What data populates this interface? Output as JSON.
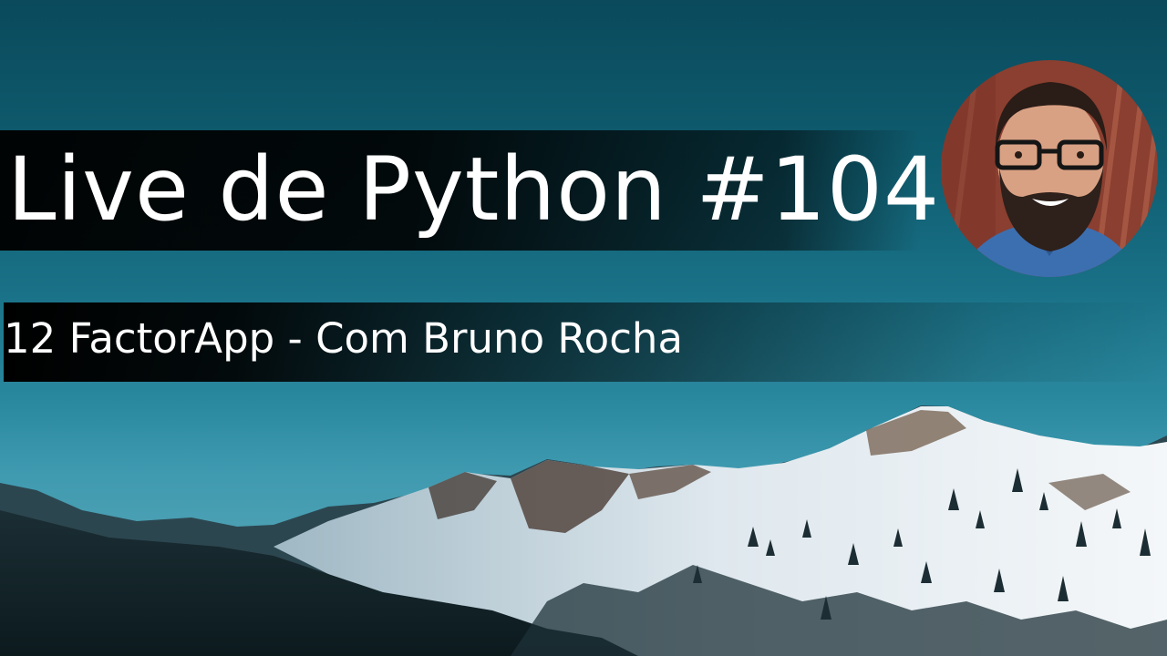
{
  "title": "Live de Python #104",
  "subtitle": "12 FactorApp - Com Bruno Rocha",
  "background_icon": "snowy-mountain-landscape",
  "avatar_icon": "host-portrait-avatar",
  "colors": {
    "sky_top": "#0a4a5c",
    "sky_bottom": "#4a9fb2",
    "text": "#ffffff",
    "banner": "#000000"
  }
}
